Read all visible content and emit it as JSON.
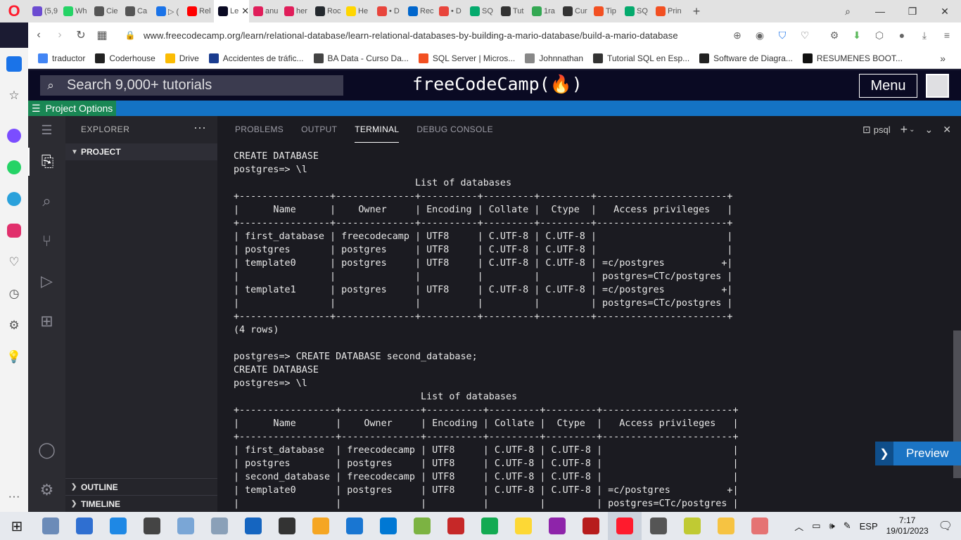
{
  "browser": {
    "tabs": [
      {
        "label": "(5,9",
        "color": "#6b4bd1"
      },
      {
        "label": "Wh",
        "color": "#25d366"
      },
      {
        "label": "Cie",
        "color": "#555555"
      },
      {
        "label": "Ca",
        "color": "#555555"
      },
      {
        "label": "▷ (",
        "color": "#1a73e8"
      },
      {
        "label": "Rel",
        "color": "#ff0000"
      },
      {
        "label": "Le",
        "color": "#0a0a23",
        "active": true
      },
      {
        "label": "anu",
        "color": "#e01e5a"
      },
      {
        "label": "her",
        "color": "#e01e5a"
      },
      {
        "label": "Roc",
        "color": "#24292e"
      },
      {
        "label": "He",
        "color": "#ffd600"
      },
      {
        "label": "• D",
        "color": "#e8453c"
      },
      {
        "label": "Rec",
        "color": "#0066cc"
      },
      {
        "label": "• D",
        "color": "#e8453c"
      },
      {
        "label": "SQ",
        "color": "#04aa6d"
      },
      {
        "label": "Tut",
        "color": "#333333"
      },
      {
        "label": "1ra",
        "color": "#34a853"
      },
      {
        "label": "Cur",
        "color": "#333333"
      },
      {
        "label": "Tip",
        "color": "#f25022"
      },
      {
        "label": "SQ",
        "color": "#04aa6d"
      },
      {
        "label": "Prin",
        "color": "#f25022"
      }
    ],
    "new_tab": "+",
    "url_host": "www.freecodecamp.org",
    "url_path": "/learn/relational-database/learn-relational-databases-by-building-a-mario-database/build-a-mario-database",
    "bookmarks": [
      {
        "label": "traductor",
        "color": "#4285f4"
      },
      {
        "label": "Coderhouse",
        "color": "#222222"
      },
      {
        "label": "Drive",
        "color": "#fbbc04"
      },
      {
        "label": "Accidentes de tráfic...",
        "color": "#1a3c8f"
      },
      {
        "label": "BA Data - Curso Da...",
        "color": "#444444"
      },
      {
        "label": "SQL Server | Micros...",
        "color": "#f25022"
      },
      {
        "label": "Johnnathan",
        "color": "#888888"
      },
      {
        "label": "Tutorial SQL en Esp...",
        "color": "#333333"
      },
      {
        "label": "Software de Diagra...",
        "color": "#222222"
      },
      {
        "label": "RESUMENES BOOT...",
        "color": "#111111"
      }
    ]
  },
  "fcc": {
    "search_placeholder": "Search 9,000+ tutorials",
    "logo": "freeCodeCamp(🔥)",
    "menu": "Menu",
    "project_options": "Project Options"
  },
  "vscode": {
    "explorer_title": "EXPLORER",
    "explorer_more": "···",
    "project": "PROJECT",
    "outline": "OUTLINE",
    "timeline": "TIMELINE",
    "panel_tabs": [
      "PROBLEMS",
      "OUTPUT",
      "TERMINAL",
      "DEBUG CONSOLE"
    ],
    "terminal_name": "psql",
    "terminal_lines": [
      "CREATE DATABASE",
      "postgres=> \\l",
      "                                List of databases",
      "+----------------+--------------+----------+---------+---------+-----------------------+",
      "|      Name      |    Owner     | Encoding | Collate |  Ctype  |   Access privileges   |",
      "+----------------+--------------+----------+---------+---------+-----------------------+",
      "| first_database | freecodecamp | UTF8     | C.UTF-8 | C.UTF-8 |                       |",
      "| postgres       | postgres     | UTF8     | C.UTF-8 | C.UTF-8 |                       |",
      "| template0      | postgres     | UTF8     | C.UTF-8 | C.UTF-8 | =c/postgres          +|",
      "|                |              |          |         |         | postgres=CTc/postgres |",
      "| template1      | postgres     | UTF8     | C.UTF-8 | C.UTF-8 | =c/postgres          +|",
      "|                |              |          |         |         | postgres=CTc/postgres |",
      "+----------------+--------------+----------+---------+---------+-----------------------+",
      "(4 rows)",
      "",
      "postgres=> CREATE DATABASE second_database;",
      "CREATE DATABASE",
      "postgres=> \\l",
      "                                 List of databases",
      "+-----------------+--------------+----------+---------+---------+-----------------------+",
      "|      Name       |    Owner     | Encoding | Collate |  Ctype  |   Access privileges   |",
      "+-----------------+--------------+----------+---------+---------+-----------------------+",
      "| first_database  | freecodecamp | UTF8     | C.UTF-8 | C.UTF-8 |                       |",
      "| postgres        | postgres     | UTF8     | C.UTF-8 | C.UTF-8 |                       |",
      "| second_database | freecodecamp | UTF8     | C.UTF-8 | C.UTF-8 |                       |",
      "| template0       | postgres     | UTF8     | C.UTF-8 | C.UTF-8 | =c/postgres          +|",
      "|                 |              |          |         |         | postgres=CTc/postgres |"
    ],
    "preview": "Preview"
  },
  "taskbar": {
    "apps": [
      {
        "name": "file-manager",
        "color": "#6b8bb8"
      },
      {
        "name": "explorer-blue",
        "color": "#2f6fd1"
      },
      {
        "name": "control-panel",
        "color": "#1e88e5"
      },
      {
        "name": "star-app",
        "color": "#444444"
      },
      {
        "name": "paint-app",
        "color": "#7aa6d6"
      },
      {
        "name": "camera-app",
        "color": "#8aa0b8"
      },
      {
        "name": "calculator",
        "color": "#1565c0"
      },
      {
        "name": "inkscape",
        "color": "#333333"
      },
      {
        "name": "globe-app",
        "color": "#f5a623"
      },
      {
        "name": "h-app",
        "color": "#1976d2"
      },
      {
        "name": "vscode",
        "color": "#0078d4"
      },
      {
        "name": "notepad-plus",
        "color": "#7cb342"
      },
      {
        "name": "filezilla",
        "color": "#c62828"
      },
      {
        "name": "mongodb",
        "color": "#13aa52"
      },
      {
        "name": "yellow-app",
        "color": "#fdd835"
      },
      {
        "name": "pride-app",
        "color": "#8e24aa"
      },
      {
        "name": "hydra-app",
        "color": "#b71c1c"
      },
      {
        "name": "opera",
        "color": "#ff1b2d",
        "active": true
      },
      {
        "name": "settings",
        "color": "#555555"
      },
      {
        "name": "tools-app",
        "color": "#c0ca33"
      },
      {
        "name": "folder",
        "color": "#f6c342"
      },
      {
        "name": "network-app",
        "color": "#e57373"
      }
    ],
    "language": "ESP",
    "time": "7:17",
    "date": "19/01/2023"
  }
}
